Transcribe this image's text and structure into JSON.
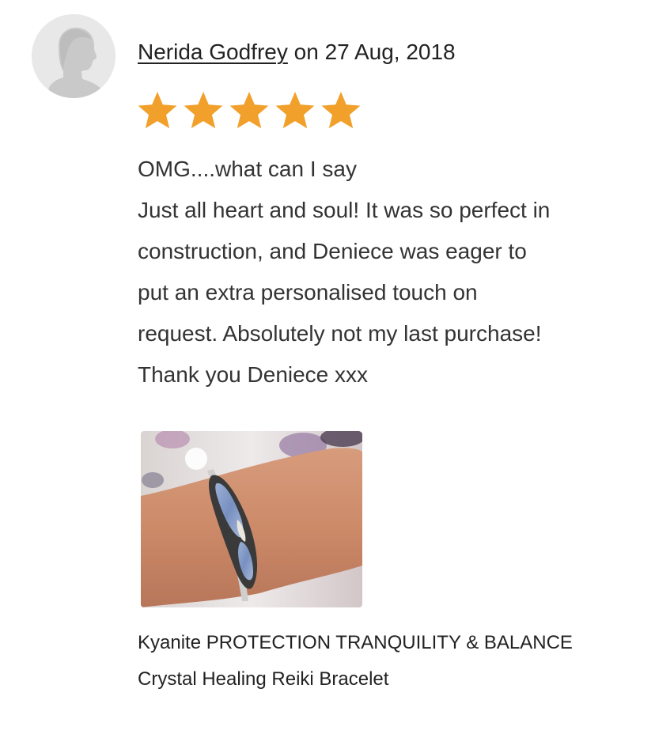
{
  "review": {
    "reviewer_name": "Nerida Godfrey",
    "date_text": " on 27 Aug, 2018",
    "rating": 5,
    "rating_max": 5,
    "star_color": "#F1A12B",
    "text_lines": [
      "OMG....what can I say",
      "Just all heart and soul! It was so perfect in",
      "construction, and Deniece was eager to",
      "put an extra personalised touch on",
      "request. Absolutely not my last purchase!",
      "Thank you Deniece xxx"
    ]
  },
  "product": {
    "image_icon": "bracelet-photo",
    "title_line1": "Kyanite PROTECTION TRANQUILITY & BALANCE",
    "title_line2": "Crystal Healing Reiki Bracelet"
  },
  "avatar": {
    "icon": "default-user-avatar-icon"
  }
}
